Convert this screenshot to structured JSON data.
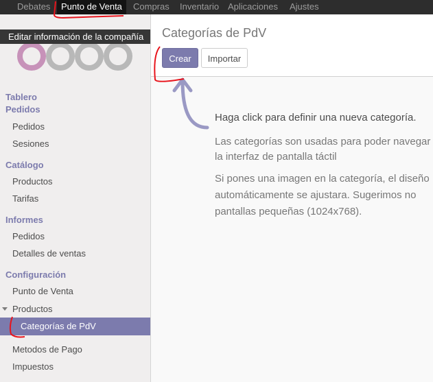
{
  "topbar": {
    "items": [
      {
        "label": "Debates"
      },
      {
        "label": "Punto de Venta"
      },
      {
        "label": "Compras"
      },
      {
        "label": "Inventario"
      },
      {
        "label": "Aplicaciones"
      },
      {
        "label": "Ajustes"
      }
    ]
  },
  "tooltip": {
    "text": "Editar información de la compañía"
  },
  "sidebar": {
    "sections": [
      {
        "title": "Tablero"
      },
      {
        "title": "Pedidos",
        "items": [
          "Pedidos",
          "Sesiones"
        ]
      },
      {
        "title": "Catálogo",
        "items": [
          "Productos",
          "Tarifas"
        ]
      },
      {
        "title": "Informes",
        "items": [
          "Pedidos",
          "Detalles de ventas"
        ]
      },
      {
        "title": "Configuración",
        "items": [
          "Punto de Venta",
          "Productos",
          "Categorías de PdV",
          "Metodos de Pago",
          "Impuestos"
        ]
      }
    ],
    "active_item": "Categorías de PdV"
  },
  "main": {
    "title": "Categorías de PdV",
    "create_label": "Crear",
    "import_label": "Importar",
    "help_title": "Haga click para definir una nueva categoría.",
    "help_lines_1": [
      "Las categorías son usadas para poder navegar",
      "la interfaz de pantalla táctil"
    ],
    "help_lines_2": [
      "Si pones una imagen en la categoría, el diseño",
      "automáticamente se ajustara. Sugerimos no",
      "pantallas pequeñas (1024x768)."
    ]
  },
  "colors": {
    "brand": "#7c7bad",
    "topbar": "#2d2d2d",
    "annotation": "#e8141c"
  }
}
